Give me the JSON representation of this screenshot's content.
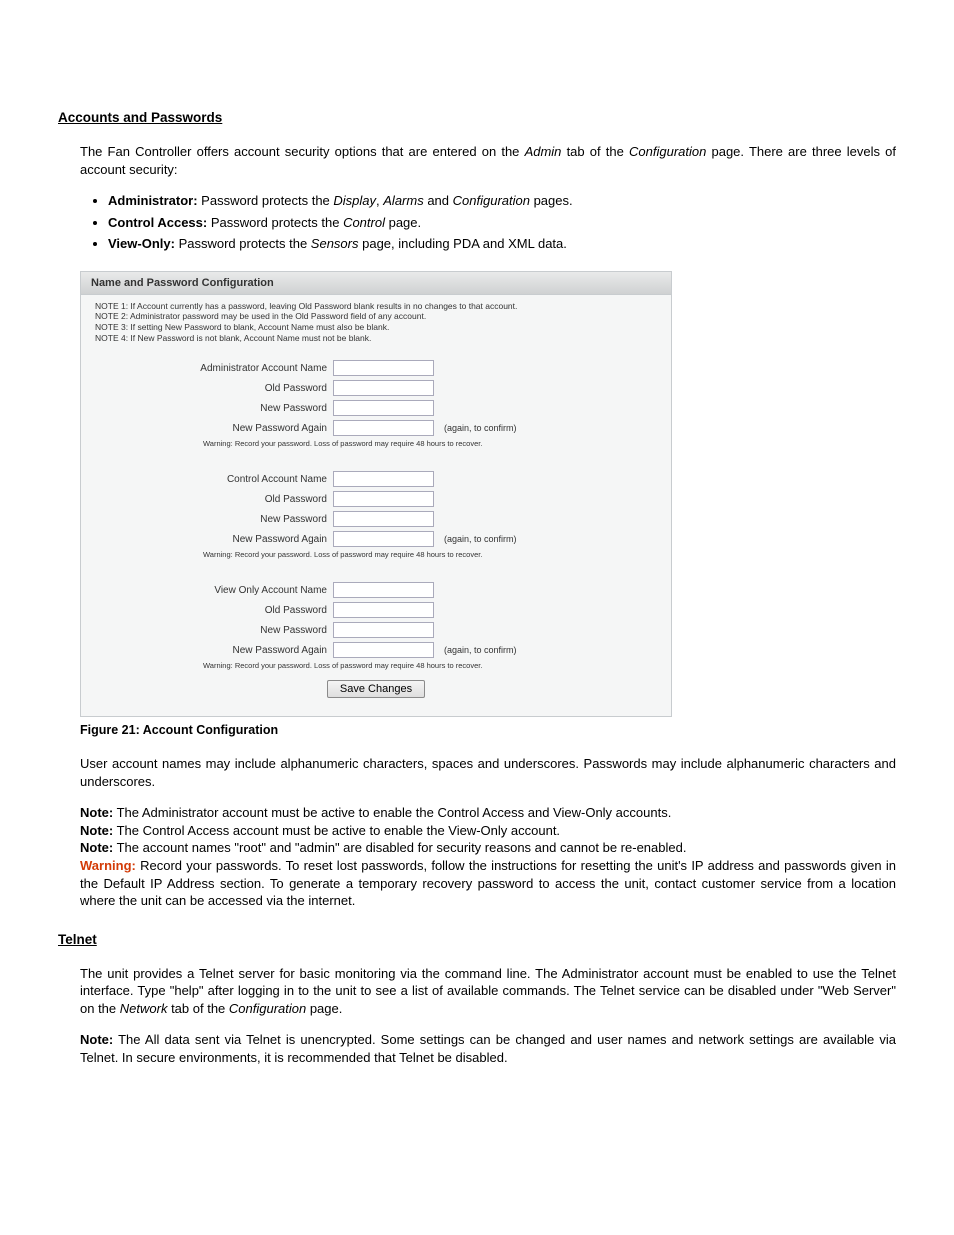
{
  "section1": {
    "heading": "Accounts and Passwords",
    "intro_pre": "The Fan Controller offers account security options that are entered on the ",
    "intro_admin": "Admin",
    "intro_mid": " tab of the ",
    "intro_config": "Configuration",
    "intro_post": " page.  There are three levels of account security:",
    "bullets": {
      "admin_bold": "Administrator:",
      "admin_pre": " Password protects the ",
      "admin_i1": "Display",
      "admin_sep1": ", ",
      "admin_i2": "Alarms",
      "admin_sep2": " and ",
      "admin_i3": "Configuration",
      "admin_post": " pages.",
      "control_bold": "Control Access:",
      "control_pre": " Password protects the ",
      "control_i": "Control",
      "control_post": " page.",
      "view_bold": "View-Only:",
      "view_pre": " Password protects the ",
      "view_i": "Sensors",
      "view_post": " page, including PDA and XML data."
    }
  },
  "panel": {
    "title": "Name and Password Configuration",
    "note1": "NOTE 1: If Account currently has a password, leaving Old Password blank results in no changes to that account.",
    "note2": "NOTE 2: Administrator password may be used in the Old Password field of any account.",
    "note3": "NOTE 3: If setting New Password to blank, Account Name must also be blank.",
    "note4": "NOTE 4: If New Password is not blank, Account Name must not be blank.",
    "groups": [
      {
        "name_label": "Administrator Account Name"
      },
      {
        "name_label": "Control Account Name"
      },
      {
        "name_label": "View Only Account Name"
      }
    ],
    "labels": {
      "old_pw": "Old Password",
      "new_pw": "New Password",
      "new_pw_again": "New Password Again",
      "again_hint": "(again, to confirm)",
      "pw_warning": "Warning: Record your password. Loss of password may require 48 hours to recover."
    },
    "save_label": "Save Changes"
  },
  "caption": "Figure 21: Account Configuration",
  "para2": "User account names may include alphanumeric characters, spaces and underscores.  Passwords may include alphanumeric characters and underscores.",
  "notes": {
    "note_label": "Note:",
    "n1": " The Administrator account must be active to enable the Control Access and View-Only accounts.",
    "n2": " The Control Access account must be active to enable the View-Only account.",
    "n3": " The account names \"root\" and \"admin\" are disabled for security reasons and cannot be re-enabled.",
    "warn_label": "Warning:",
    "warn": " Record your passwords.  To reset lost passwords, follow the instructions for resetting the unit's IP address and passwords given in the Default IP Address section.  To generate a temporary recovery password to access the unit, contact customer service from a location where the unit can be accessed via the internet."
  },
  "section2": {
    "heading": "Telnet",
    "p1_pre": "The unit provides a Telnet server for basic monitoring via the command line.  The Administrator account must be enabled to use the Telnet interface.  Type \"help\" after logging in to the unit to see a list of available commands.  The Telnet service can be disabled under \"Web Server\" on the ",
    "p1_i1": "Network",
    "p1_mid": " tab of the ",
    "p1_i2": "Configuration",
    "p1_post": " page.",
    "note_label": "Note:",
    "p2": " The All data sent via Telnet is unencrypted.  Some settings can be changed and user names and network settings are available via Telnet.  In secure environments, it is recommended that Telnet be disabled."
  }
}
